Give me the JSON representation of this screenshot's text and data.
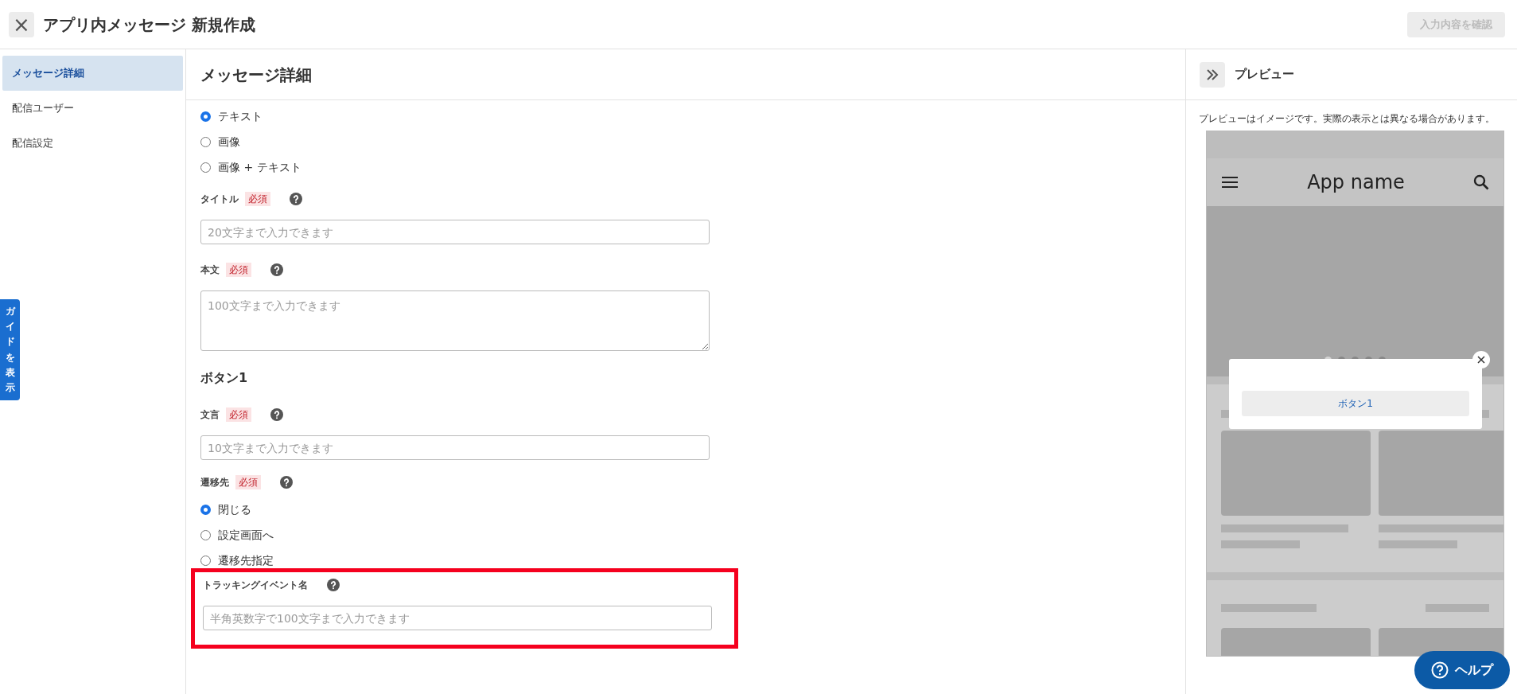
{
  "header": {
    "close_label": "×",
    "title": "アプリ内メッセージ 新規作成",
    "confirm_button": {
      "label": "入力内容を確認",
      "disabled": true
    }
  },
  "sidebar": {
    "items": [
      {
        "label": "メッセージ詳細",
        "selected": true
      },
      {
        "label": "配信ユーザー",
        "selected": false
      },
      {
        "label": "配信設定",
        "selected": false
      }
    ]
  },
  "guide_tab": {
    "label": "ガイドを表示"
  },
  "main": {
    "title": "メッセージ詳細",
    "items": [
      {
        "kind": "radios",
        "options": [
          {
            "label": "テキスト",
            "selected": true
          },
          {
            "label": "画像",
            "selected": false
          },
          {
            "label": "画像 + テキスト",
            "selected": false
          }
        ]
      },
      {
        "kind": "input",
        "label": "タイトル",
        "required": "必須",
        "placeholder": "20文字まで入力できます",
        "highlighted": false
      },
      {
        "kind": "textarea",
        "label": "本文",
        "required": "必須",
        "placeholder": "100文字まで入力できます"
      },
      {
        "kind": "heading",
        "label": "ボタン1"
      },
      {
        "kind": "input",
        "label": "文言",
        "required": "必須",
        "placeholder": "10文字まで入力できます",
        "highlighted": false
      },
      {
        "kind": "label",
        "label": "遷移先",
        "required": "必須"
      },
      {
        "kind": "radios",
        "options": [
          {
            "label": "閉じる",
            "selected": true
          },
          {
            "label": "設定画面へ",
            "selected": false
          },
          {
            "label": "遷移先指定",
            "selected": false
          }
        ]
      },
      {
        "kind": "input",
        "label": "トラッキングイベント名",
        "placeholder": "半角英数字で100文字まで入力できます",
        "highlighted": true
      }
    ]
  },
  "preview": {
    "title": "プレビュー",
    "note": "プレビューはイメージです。実際の表示とは異なる場合があります。",
    "app_name": "App name",
    "carousel_dots": [
      {
        "selected": true
      },
      {
        "selected": false
      },
      {
        "selected": false
      },
      {
        "selected": false
      },
      {
        "selected": false
      }
    ],
    "popup_button": "ボタン1"
  },
  "help_button": {
    "label": "ヘルプ"
  }
}
